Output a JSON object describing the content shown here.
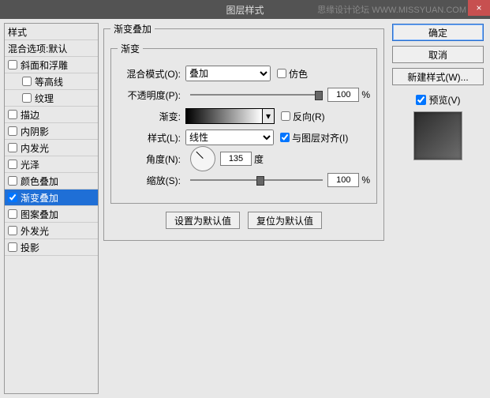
{
  "title": "图层样式",
  "watermark": "思缘设计论坛  WWW.MISSYUAN.COM",
  "close": "×",
  "left": {
    "styles": "样式",
    "blend": "混合选项:默认",
    "items": [
      "斜面和浮雕",
      "等高线",
      "纹理",
      "描边",
      "内阴影",
      "内发光",
      "光泽",
      "颜色叠加",
      "渐变叠加",
      "图案叠加",
      "外发光",
      "投影"
    ],
    "selectedIndex": 8
  },
  "panel": {
    "legend": "渐变叠加",
    "innerLegend": "渐变",
    "blendModeLabel": "混合模式(O):",
    "blendModeValue": "叠加",
    "dither": "仿色",
    "opacityLabel": "不透明度(P):",
    "opacityValue": "100",
    "pct": "%",
    "gradientLabel": "渐变:",
    "reverse": "反向(R)",
    "styleLabel": "样式(L):",
    "styleValue": "线性",
    "alignLayer": "与图层对齐(I)",
    "angleLabel": "角度(N):",
    "angleValue": "135",
    "degree": "度",
    "scaleLabel": "缩放(S):",
    "scaleValue": "100",
    "setDefault": "设置为默认值",
    "resetDefault": "复位为默认值",
    "dropdownArrow": "▾"
  },
  "right": {
    "ok": "确定",
    "cancel": "取消",
    "newStyle": "新建样式(W)...",
    "preview": "预览(V)"
  }
}
